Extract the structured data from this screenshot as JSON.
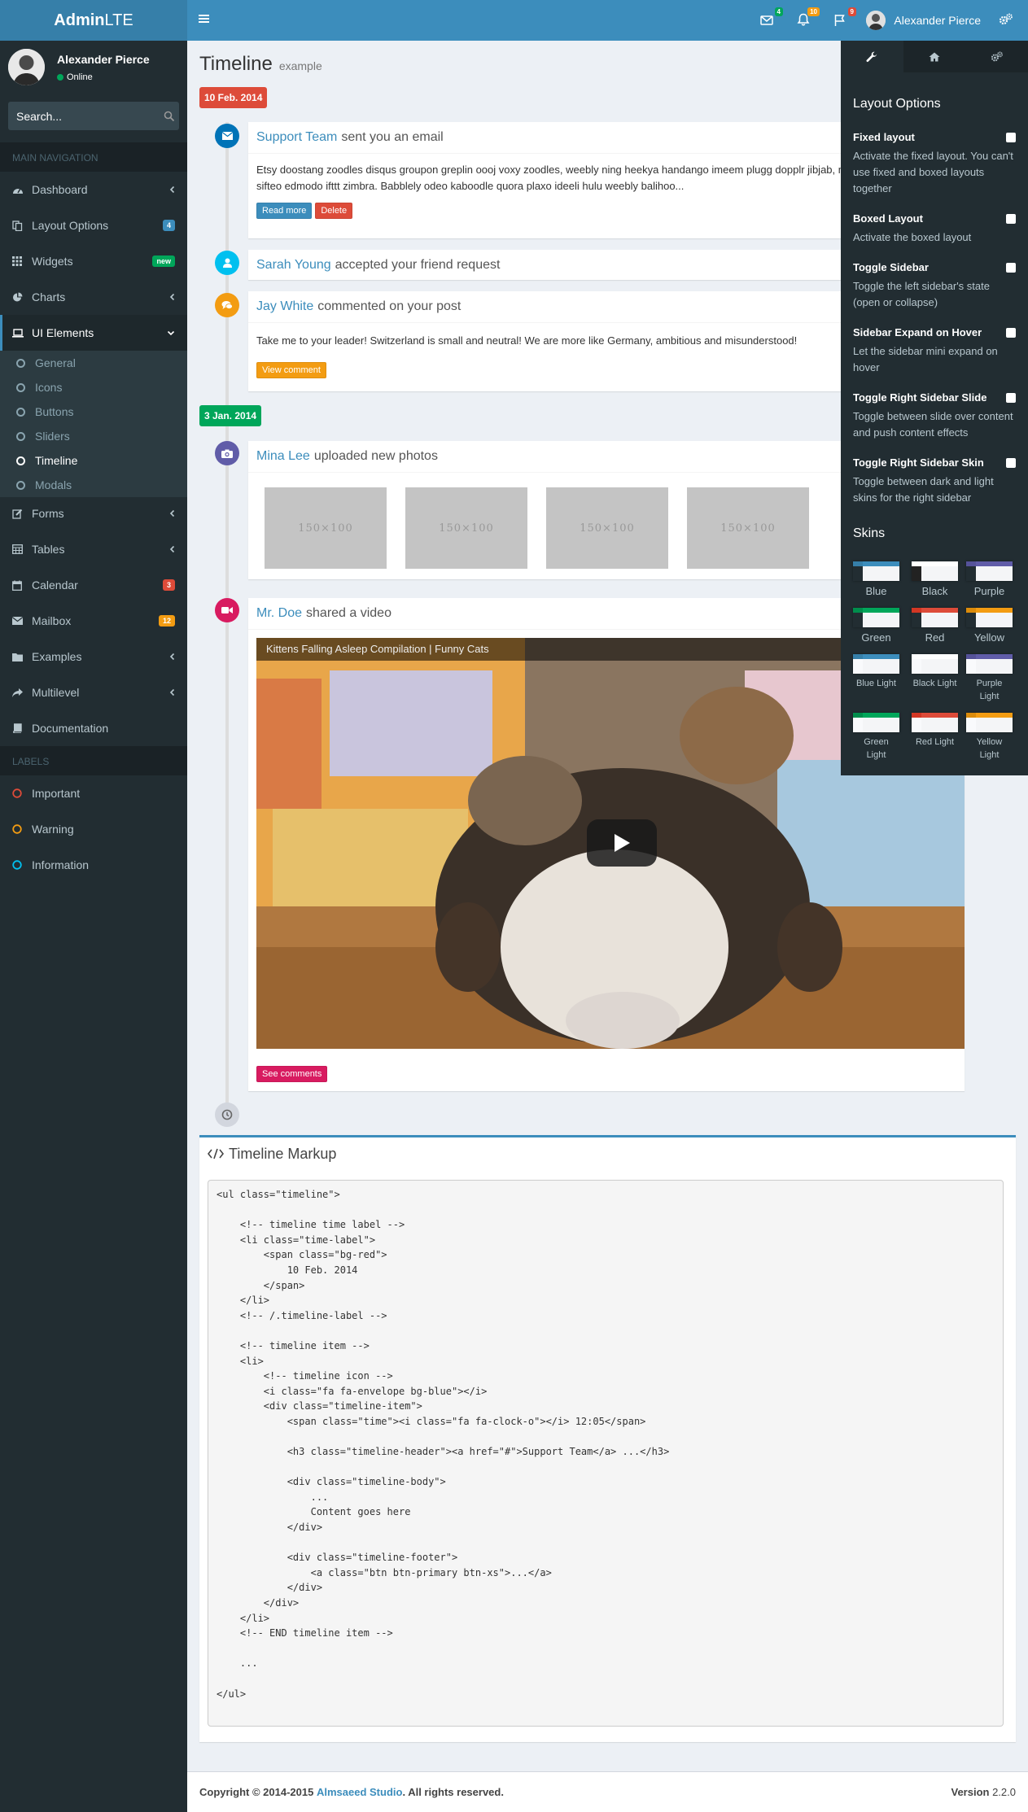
{
  "brand": {
    "bold": "Admin",
    "light": "LTE"
  },
  "navbar": {
    "messages_count": "4",
    "notifications_count": "10",
    "tasks_count": "9",
    "user_name": "Alexander Pierce"
  },
  "sidebar": {
    "user_name": "Alexander Pierce",
    "user_status": "Online",
    "search_placeholder": "Search...",
    "main_header": "MAIN NAVIGATION",
    "items": [
      {
        "label": "Dashboard",
        "icon": "dashboard-icon"
      },
      {
        "label": "Layout Options",
        "icon": "files-icon",
        "badge": "4"
      },
      {
        "label": "Widgets",
        "icon": "th-icon",
        "badge": "new"
      },
      {
        "label": "Charts",
        "icon": "pie-chart-icon"
      },
      {
        "label": "UI Elements",
        "icon": "laptop-icon"
      },
      {
        "label": "Forms",
        "icon": "edit-icon"
      },
      {
        "label": "Tables",
        "icon": "table-icon"
      },
      {
        "label": "Calendar",
        "icon": "calendar-icon",
        "badge": "3"
      },
      {
        "label": "Mailbox",
        "icon": "envelope-icon",
        "badge": "12"
      },
      {
        "label": "Examples",
        "icon": "folder-icon"
      },
      {
        "label": "Multilevel",
        "icon": "share-icon"
      },
      {
        "label": "Documentation",
        "icon": "book-icon"
      }
    ],
    "sub_items": [
      "General",
      "Icons",
      "Buttons",
      "Sliders",
      "Timeline",
      "Modals"
    ],
    "labels_header": "LABELS",
    "labels": [
      {
        "label": "Important",
        "color": "#dd4b39"
      },
      {
        "label": "Warning",
        "color": "#f39c12"
      },
      {
        "label": "Information",
        "color": "#00c0ef"
      }
    ]
  },
  "page": {
    "title": "Timeline",
    "subtitle": "example"
  },
  "timeline": {
    "label1": "10 Feb. 2014",
    "label2": "3 Jan. 2014",
    "item1": {
      "author": "Support Team",
      "action": "sent you an email",
      "body": "Etsy doostang zoodles disqus groupon greplin oooj voxy zoodles, weebly ning heekya handango imeem plugg dopplr jibjab, movity jajah plickers sifteo edmodo ifttt zimbra. Babblely odeo kaboodle quora plaxo ideeli hulu weebly balihoo...",
      "read_more": "Read more",
      "delete": "Delete"
    },
    "item2": {
      "author": "Sarah Young",
      "action": "accepted your friend request"
    },
    "item3": {
      "author": "Jay White",
      "action": "commented on your post",
      "body": "Take me to your leader! Switzerland is small and neutral! We are more like Germany, ambitious and misunderstood!",
      "button": "View comment"
    },
    "item4": {
      "author": "Mina Lee",
      "action": "uploaded new photos",
      "photo_label": "150×100"
    },
    "item5": {
      "author": "Mr. Doe",
      "action": "shared a video",
      "video_title": "Kittens Falling Asleep Compilation | Funny Cats",
      "button": "See comments"
    }
  },
  "markup_box": {
    "title": "Timeline Markup",
    "code": "<ul class=\"timeline\">\n\n    <!-- timeline time label -->\n    <li class=\"time-label\">\n        <span class=\"bg-red\">\n            10 Feb. 2014\n        </span>\n    </li>\n    <!-- /.timeline-label -->\n\n    <!-- timeline item -->\n    <li>\n        <!-- timeline icon -->\n        <i class=\"fa fa-envelope bg-blue\"></i>\n        <div class=\"timeline-item\">\n            <span class=\"time\"><i class=\"fa fa-clock-o\"></i> 12:05</span>\n\n            <h3 class=\"timeline-header\"><a href=\"#\">Support Team</a> ...</h3>\n\n            <div class=\"timeline-body\">\n                ...\n                Content goes here\n            </div>\n\n            <div class=\"timeline-footer\">\n                <a class=\"btn btn-primary btn-xs\">...</a>\n            </div>\n        </div>\n    </li>\n    <!-- END timeline item -->\n\n    ...\n\n</ul>"
  },
  "footer": {
    "copyright_prefix": "Copyright © 2014-2015",
    "company": "Almsaeed Studio",
    "copyright_suffix": ". All rights reserved.",
    "version_label": "Version",
    "version": "2.2.0"
  },
  "control_sidebar": {
    "layout_heading": "Layout Options",
    "options": [
      {
        "title": "Fixed layout",
        "desc": "Activate the fixed layout. You can't use fixed and boxed layouts together"
      },
      {
        "title": "Boxed Layout",
        "desc": "Activate the boxed layout"
      },
      {
        "title": "Toggle Sidebar",
        "desc": "Toggle the left sidebar's state (open or collapse)"
      },
      {
        "title": "Sidebar Expand on Hover",
        "desc": "Let the sidebar mini expand on hover"
      },
      {
        "title": "Toggle Right Sidebar Slide",
        "desc": "Toggle between slide over content and push content effects"
      },
      {
        "title": "Toggle Right Sidebar Skin",
        "desc": "Toggle between dark and light skins for the right sidebar"
      }
    ],
    "skins_heading": "Skins",
    "skins": [
      {
        "label": "Blue",
        "top": "#367fa9",
        "head": "#3c8dbc",
        "side": "#222d32"
      },
      {
        "label": "Black",
        "top": "#fefefe",
        "head": "#fefefe",
        "side": "#222"
      },
      {
        "label": "Purple",
        "top": "#555299",
        "head": "#605ca8",
        "side": "#222d32"
      },
      {
        "label": "Green",
        "top": "#008d4c",
        "head": "#00a65a",
        "side": "#222d32"
      },
      {
        "label": "Red",
        "top": "#d33724",
        "head": "#dd4b39",
        "side": "#222d32"
      },
      {
        "label": "Yellow",
        "top": "#db8b0b",
        "head": "#f39c12",
        "side": "#222d32"
      },
      {
        "label": "Blue Light",
        "top": "#367fa9",
        "head": "#3c8dbc",
        "side": "#f9fafc"
      },
      {
        "label": "Black Light",
        "top": "#fefefe",
        "head": "#fefefe",
        "side": "#f9fafc"
      },
      {
        "label": "Purple Light",
        "top": "#555299",
        "head": "#605ca8",
        "side": "#f9fafc"
      },
      {
        "label": "Green Light",
        "top": "#008d4c",
        "head": "#00a65a",
        "side": "#f9fafc"
      },
      {
        "label": "Red Light",
        "top": "#d33724",
        "head": "#dd4b39",
        "side": "#f9fafc"
      },
      {
        "label": "Yellow Light",
        "top": "#db8b0b",
        "head": "#f39c12",
        "side": "#f9fafc"
      }
    ]
  },
  "colors": {
    "primary": "#3c8dbc",
    "red": "#dd4b39",
    "green": "#00a65a",
    "yellow": "#f39c12",
    "aqua": "#00c0ef",
    "purple": "#605ca8",
    "maroon": "#d81b60",
    "gray": "#d2d6de"
  }
}
